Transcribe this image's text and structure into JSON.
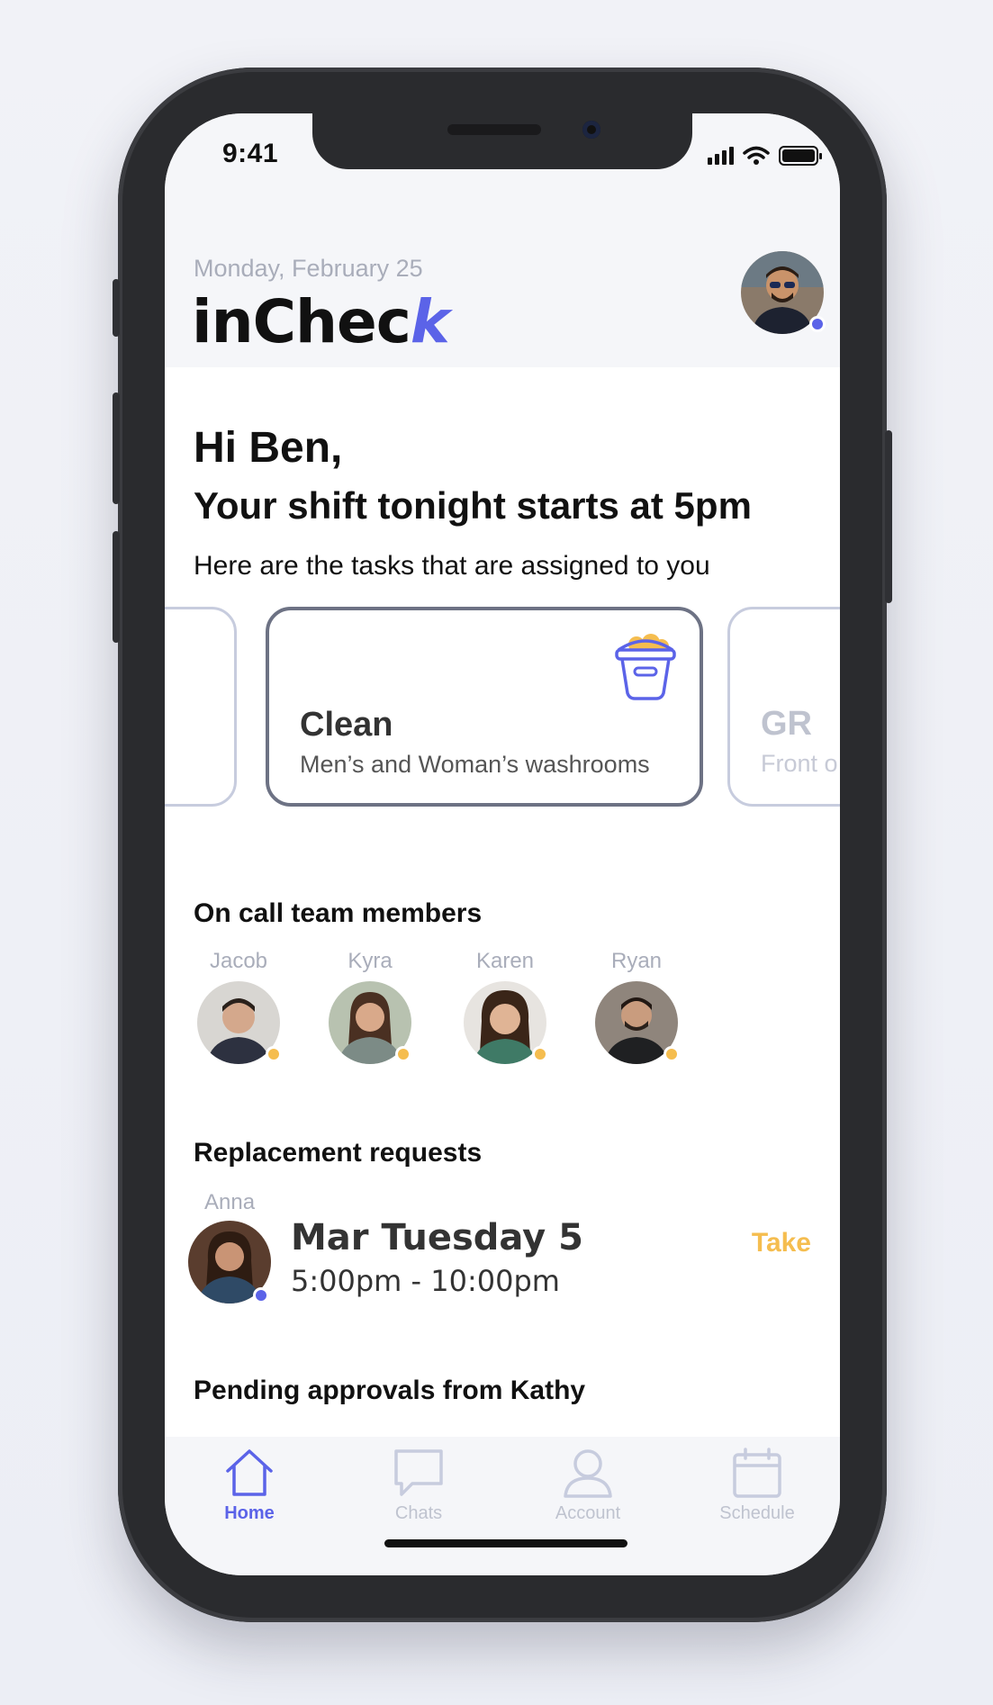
{
  "status_bar": {
    "time": "9:41"
  },
  "header": {
    "date": "Monday, February 25",
    "logo_main": "inChec",
    "logo_accent": "k"
  },
  "greeting": {
    "hello": "Hi Ben,",
    "shift": "Your shift tonight starts at 5pm",
    "tasks_intro": "Here are the tasks that are assigned to you"
  },
  "tasks": [
    {
      "title": "Clean",
      "subtitle": "Men’s and Woman’s washrooms",
      "icon": "bucket-icon"
    },
    {
      "title": "GR",
      "subtitle": "Front o"
    }
  ],
  "on_call": {
    "title": "On call team members",
    "members": [
      {
        "name": "Jacob",
        "status_color": "#f5bd4f"
      },
      {
        "name": "Kyra",
        "status_color": "#f5bd4f"
      },
      {
        "name": "Karen",
        "status_color": "#f5bd4f"
      },
      {
        "name": "Ryan",
        "status_color": "#f5bd4f"
      }
    ]
  },
  "replacement": {
    "title": "Replacement requests",
    "requester": "Anna",
    "date": "Mar Tuesday 5",
    "time": "5:00pm - 10:00pm",
    "action": "Take"
  },
  "pending": {
    "title": "Pending approvals from Kathy"
  },
  "tab_bar": {
    "tabs": [
      {
        "label": "Home",
        "icon": "home-icon",
        "active": true
      },
      {
        "label": "Chats",
        "icon": "chat-icon",
        "active": false
      },
      {
        "label": "Account",
        "icon": "account-icon",
        "active": false
      },
      {
        "label": "Schedule",
        "icon": "calendar-icon",
        "active": false
      }
    ]
  },
  "colors": {
    "accent": "#5b63e8",
    "warning": "#f5bd4f",
    "muted": "#a9adba"
  }
}
